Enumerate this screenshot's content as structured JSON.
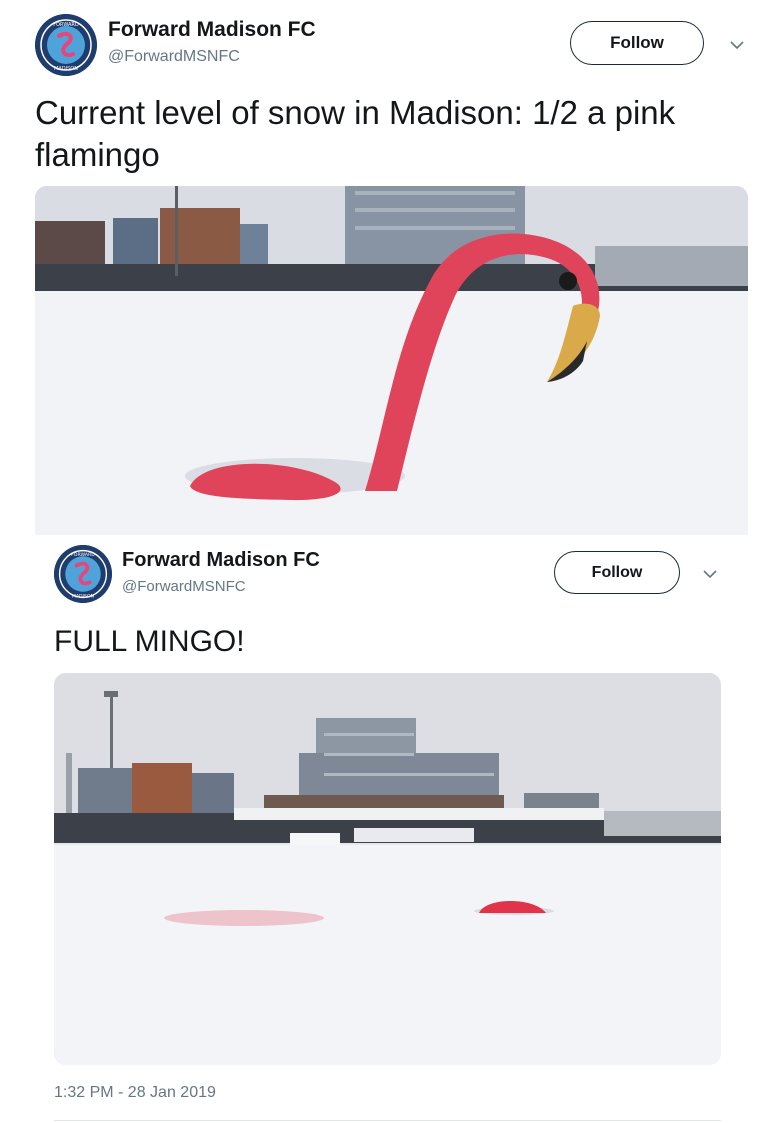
{
  "tweet1": {
    "display_name": "Forward Madison FC",
    "handle": "@ForwardMSNFC",
    "follow_label": "Follow",
    "text": "Current level of snow in Madison: 1/2 a pink flamingo",
    "avatar_icon": "forward-madison-crest",
    "media_description_icon": "flamingo-half-snow-photo"
  },
  "tweet2": {
    "display_name": "Forward Madison FC",
    "handle": "@ForwardMSNFC",
    "follow_label": "Follow",
    "text": "FULL MINGO!",
    "timestamp": "1:32 PM - 28 Jan 2019",
    "avatar_icon": "forward-madison-crest",
    "media_description_icon": "flamingo-buried-snow-photo"
  },
  "colors": {
    "text": "#14171a",
    "secondary": "#657786",
    "flamingo": "#e0445a",
    "snow": "#f3f4f7",
    "crest": "#1f3c6e"
  }
}
